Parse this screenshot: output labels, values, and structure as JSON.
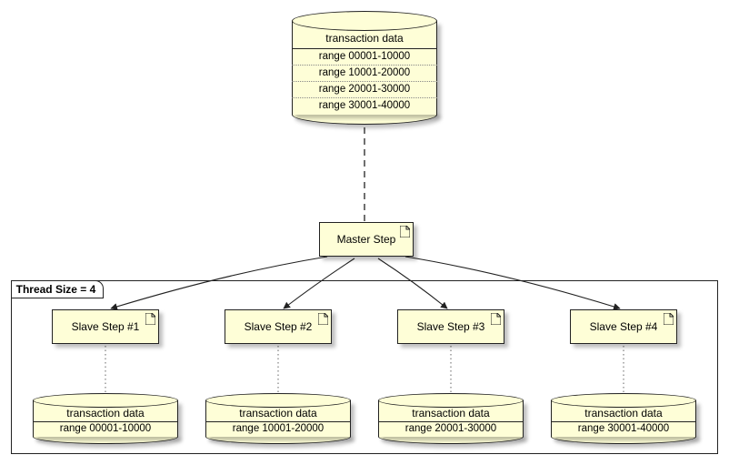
{
  "main_db": {
    "title": "transaction data",
    "rows": [
      "range 00001-10000",
      "range 10001-20000",
      "range 20001-30000",
      "range 30001-40000"
    ]
  },
  "master": {
    "label": "Master Step"
  },
  "thread_frame": {
    "label": "Thread Size = 4"
  },
  "slaves": [
    {
      "label": "Slave Step #1"
    },
    {
      "label": "Slave Step #2"
    },
    {
      "label": "Slave Step #3"
    },
    {
      "label": "Slave Step #4"
    }
  ],
  "slave_dbs": [
    {
      "title": "transaction data",
      "range": "range 00001-10000"
    },
    {
      "title": "transaction data",
      "range": "range 10001-20000"
    },
    {
      "title": "transaction data",
      "range": "range 20001-30000"
    },
    {
      "title": "transaction data",
      "range": "range 30001-40000"
    }
  ]
}
